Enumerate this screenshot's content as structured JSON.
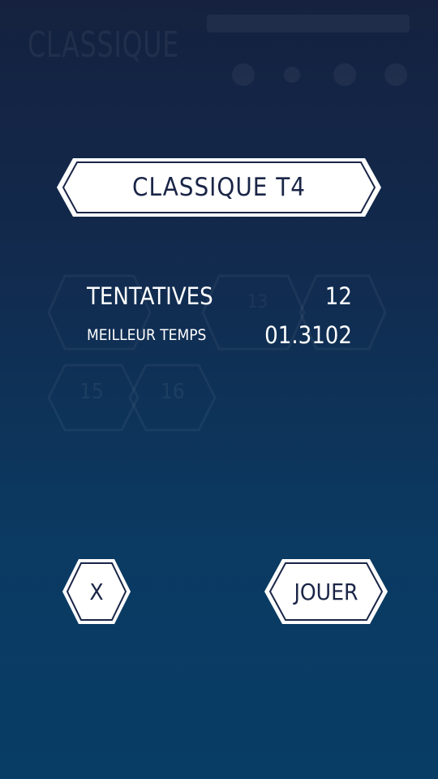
{
  "background": {
    "faded_title": "CLASSIQUE",
    "faded_numbers": [
      "13",
      "15",
      "16"
    ]
  },
  "dialog": {
    "title": "CLASSIQUE T4",
    "stats": [
      {
        "label": "TENTATIVES",
        "value": "12"
      },
      {
        "label": "MEILLEUR TEMPS",
        "value": "01.3102"
      }
    ]
  },
  "buttons": {
    "close_label": "X",
    "play_label": "JOUER"
  },
  "colors": {
    "bg_top": "#15213f",
    "bg_bottom": "#083d66",
    "panel_fill": "#ffffff",
    "panel_text": "#1a2547"
  }
}
